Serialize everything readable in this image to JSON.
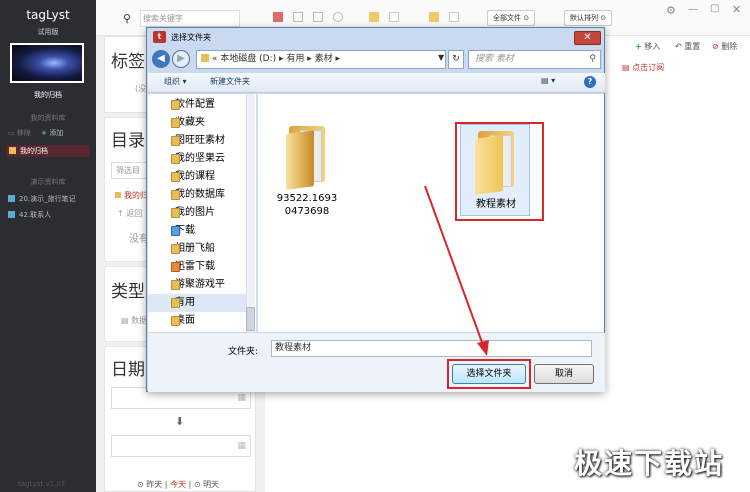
{
  "app": {
    "title": "tagLyst",
    "edition": "试用版",
    "archive_label": "我的归档",
    "version": "v1.07"
  },
  "sidebar": {
    "library_section": "我的资料库",
    "actions": [
      "移除",
      "添加"
    ],
    "selected_item": "我的归档",
    "demo_section": "演示资料库",
    "demo_items": [
      "20.演示_旅行笔记",
      "42.联系人"
    ]
  },
  "toolbar": {
    "search_placeholder": "搜索关键字",
    "filter_all": "全部文件",
    "sort_default": "默认排列",
    "import": "移入",
    "reset": "重置",
    "delete": "删除",
    "click_subscribe": "点击订阅"
  },
  "panels": {
    "tags_title": "标签",
    "tags_empty": "(没",
    "dir_title": "目录",
    "dir_filter": "筛选目",
    "dir_item": "我的归",
    "dir_back": "返回",
    "dir_empty": "没有",
    "type_title": "类型",
    "type_item": "数据",
    "date_title": "日期",
    "date_links": [
      "昨天",
      "今天",
      "明天"
    ]
  },
  "dialog": {
    "title": "选择文件夹",
    "close": "✕",
    "address": [
      "«",
      "本地磁盘 (D:)",
      "有用",
      "素材"
    ],
    "search_placeholder": "搜索 素材",
    "organize": "组织",
    "new_folder": "新建文件夹",
    "tree": [
      {
        "label": "软件配置",
        "kind": "folder"
      },
      {
        "label": "收藏夹",
        "kind": "folder"
      },
      {
        "label": "图旺旺素材",
        "kind": "folder"
      },
      {
        "label": "我的坚果云",
        "kind": "folder"
      },
      {
        "label": "我的课程",
        "kind": "folder"
      },
      {
        "label": "我的数据库",
        "kind": "folder"
      },
      {
        "label": "我的图片",
        "kind": "folder"
      },
      {
        "label": "下载",
        "kind": "blue"
      },
      {
        "label": "相册飞船",
        "kind": "folder"
      },
      {
        "label": "迅雷下载",
        "kind": "orange"
      },
      {
        "label": "游聚游戏平",
        "kind": "folder"
      },
      {
        "label": "有用",
        "kind": "folder",
        "selected": true
      },
      {
        "label": "桌面",
        "kind": "folder"
      }
    ],
    "files": [
      {
        "label": "93522.1693\n0473698"
      },
      {
        "label": "教程素材",
        "selected": true
      }
    ],
    "folder_label": "文件夹:",
    "folder_value": "教程素材",
    "select_button": "选择文件夹",
    "cancel_button": "取消"
  },
  "watermark": "极速下载站",
  "colors": {
    "sidebar_bg": "#2b2d33",
    "highlight_red": "#d9262a",
    "dialog_frame": "#c9daf0"
  }
}
